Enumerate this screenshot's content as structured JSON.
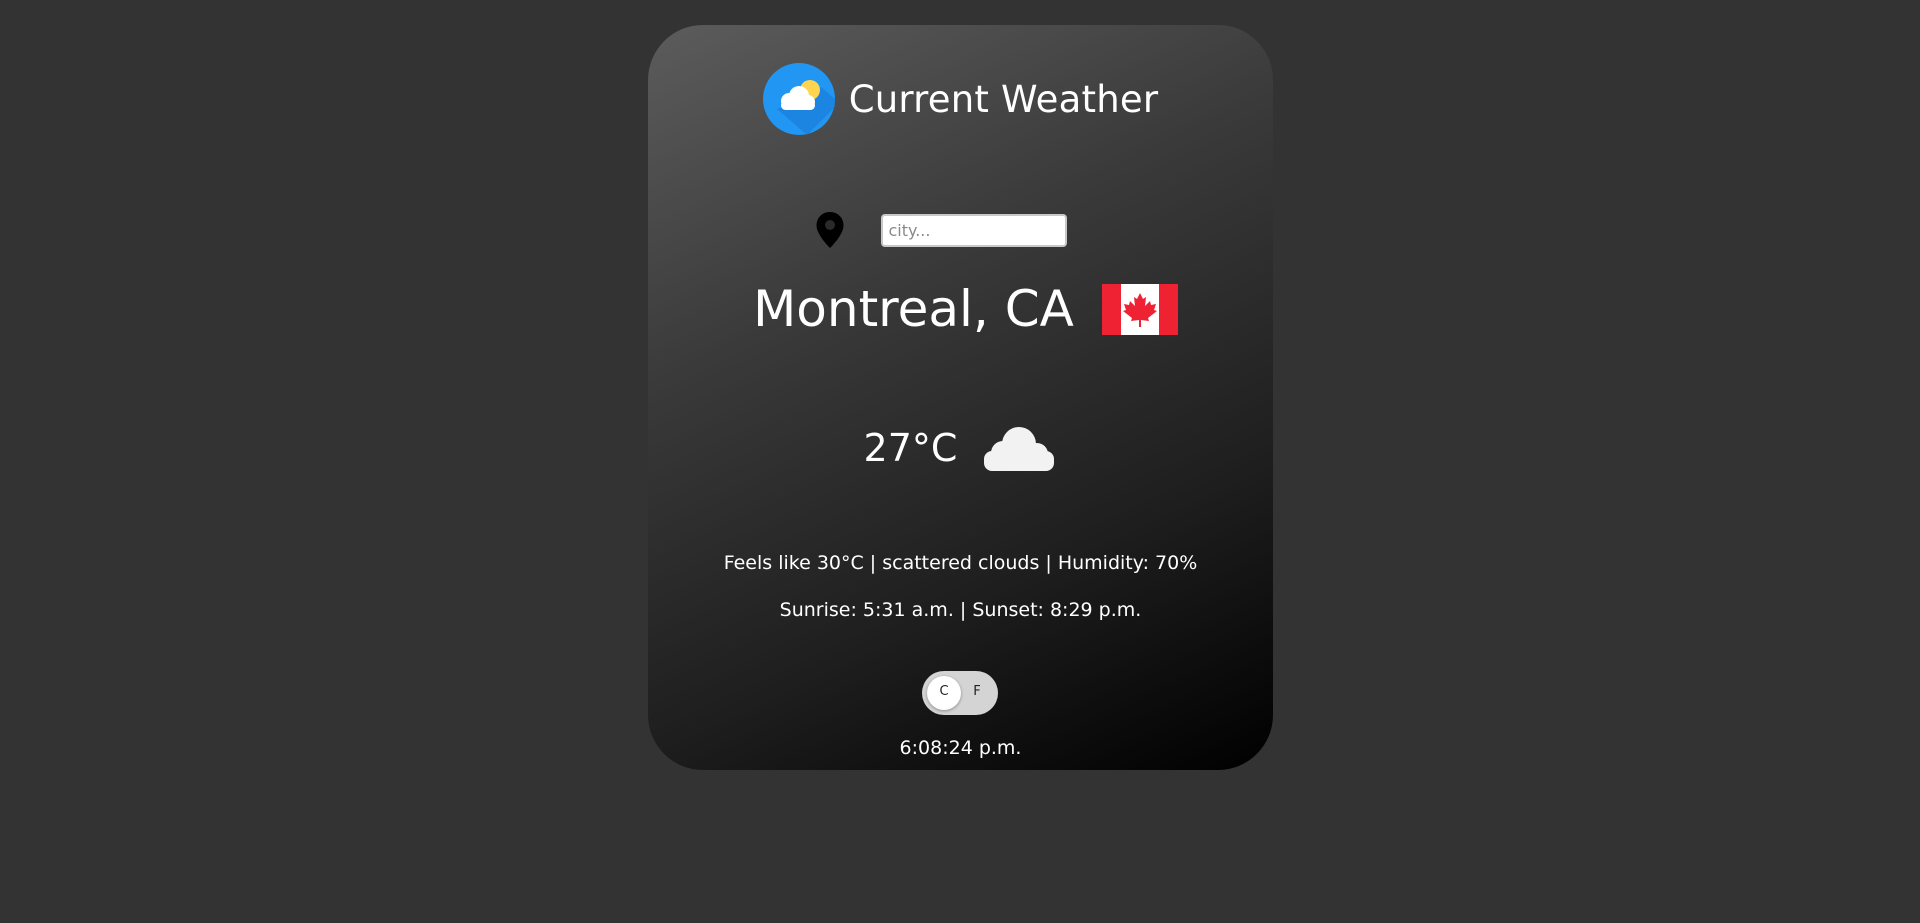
{
  "app": {
    "title": "Current Weather",
    "logo_icon": "partly-cloudy-icon"
  },
  "search": {
    "placeholder": "city...",
    "value": "",
    "icon": "location-pin-icon"
  },
  "location": {
    "name": "Montreal, CA",
    "flag_icon": "canada-flag-icon"
  },
  "weather": {
    "temperature": "27°C",
    "condition_icon": "cloud-icon",
    "details": "Feels like 30°C | scattered clouds | Humidity: 70%",
    "sun_times": "Sunrise: 5:31 a.m. | Sunset: 8:29 p.m."
  },
  "unit_toggle": {
    "celsius_label": "C",
    "fahrenheit_label": "F",
    "selected": "C"
  },
  "clock": {
    "time": "6:08:24 p.m."
  },
  "colors": {
    "page_background": "#333333",
    "card_gradient_start": "#5c5c5c",
    "card_gradient_end": "#000000",
    "logo_blue": "#2196f3",
    "sun_yellow": "#ffd54f",
    "flag_red": "#ee2233",
    "toggle_track": "#d4d4d4"
  }
}
